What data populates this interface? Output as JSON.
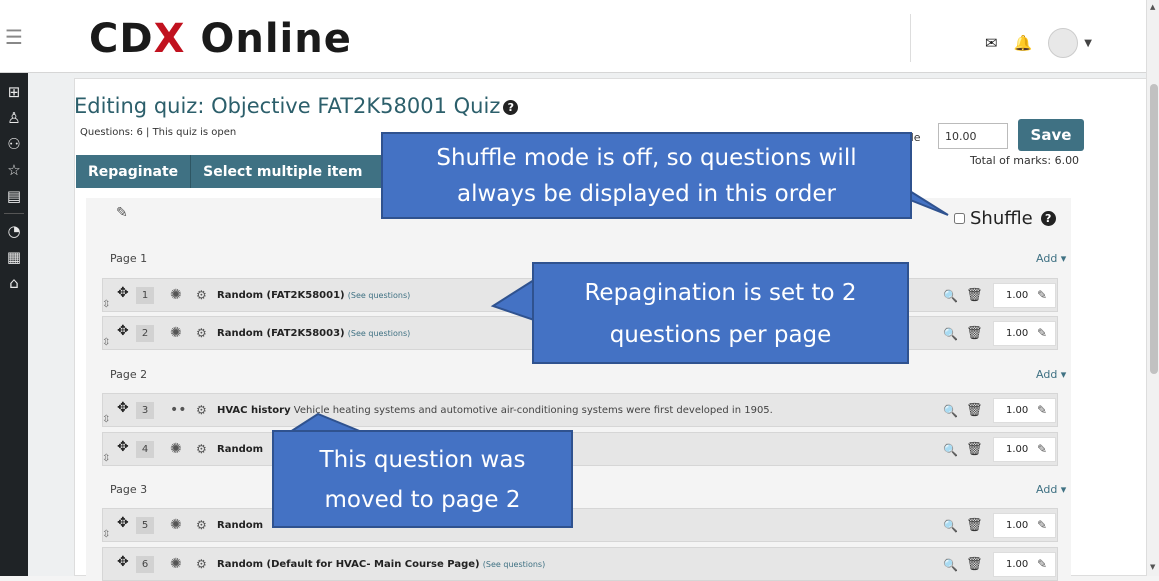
{
  "header": {
    "menu_icon": "hamburger-icon",
    "logo_part1": "CD",
    "logo_x": "X",
    "logo_part2": "Online",
    "icons": [
      "envelope-icon",
      "bell-icon",
      "user-avatar",
      "caret-down-icon"
    ]
  },
  "sidebar": {
    "items": [
      "dashboard-icon",
      "people-icon",
      "badge-icon",
      "star-icon",
      "book-icon",
      "gauge-icon",
      "calendar-icon",
      "graduation-cap-icon"
    ]
  },
  "quiz": {
    "title": "Editing quiz: Objective FAT2K58001 Quiz",
    "help": "?",
    "info": "Questions: 6 | This quiz is open",
    "toolbar": {
      "repaginate": "Repaginate",
      "select_multiple": "Select multiple item"
    },
    "max_grade_label": "ade",
    "max_grade_value": "10.00",
    "save_label": "Save",
    "total_marks": "Total of marks: 6.00",
    "shuffle_label": "Shuffle",
    "shuffle_checked": false
  },
  "pages": [
    {
      "label": "Page 1",
      "add": "Add ▾"
    },
    {
      "label": "Page 2",
      "add": "Add ▾"
    },
    {
      "label": "Page 3",
      "add": "Add ▾"
    }
  ],
  "questions": [
    {
      "num": "1",
      "icon": "random-question-icon",
      "name": "Random (FAT2K58001)",
      "see": "(See questions)",
      "desc": "",
      "mark": "1.00"
    },
    {
      "num": "2",
      "icon": "random-question-icon",
      "name": "Random (FAT2K58003)",
      "see": "(See questions)",
      "desc": "",
      "mark": "1.00"
    },
    {
      "num": "3",
      "icon": "true-false-icon",
      "name": "HVAC history",
      "see": "",
      "desc": "Vehicle heating systems and automotive air-conditioning systems were first developed in 1905.",
      "mark": "1.00"
    },
    {
      "num": "4",
      "icon": "random-question-icon",
      "name": "Random",
      "see": "",
      "desc": "",
      "mark": "1.00"
    },
    {
      "num": "5",
      "icon": "random-question-icon",
      "name": "Random",
      "see": "",
      "desc": "",
      "mark": "1.00"
    },
    {
      "num": "6",
      "icon": "random-question-icon",
      "name": "Random (Default for HVAC- Main Course Page)",
      "see": "(See questions)",
      "desc": "",
      "mark": "1.00"
    }
  ],
  "callouts": {
    "shuffle_line1": "Shuffle mode is off, so questions will",
    "shuffle_line2": "always be displayed in this order",
    "repaginate_line1": "Repagination is set to 2",
    "repaginate_line2": "questions per page",
    "moved_line1": "This question was",
    "moved_line2": "moved to page 2"
  },
  "colors": {
    "teal": "#3f7183",
    "callout_blue": "#4472c4",
    "logo_red": "#c1121f",
    "sidebar_dark": "#1f2326"
  }
}
